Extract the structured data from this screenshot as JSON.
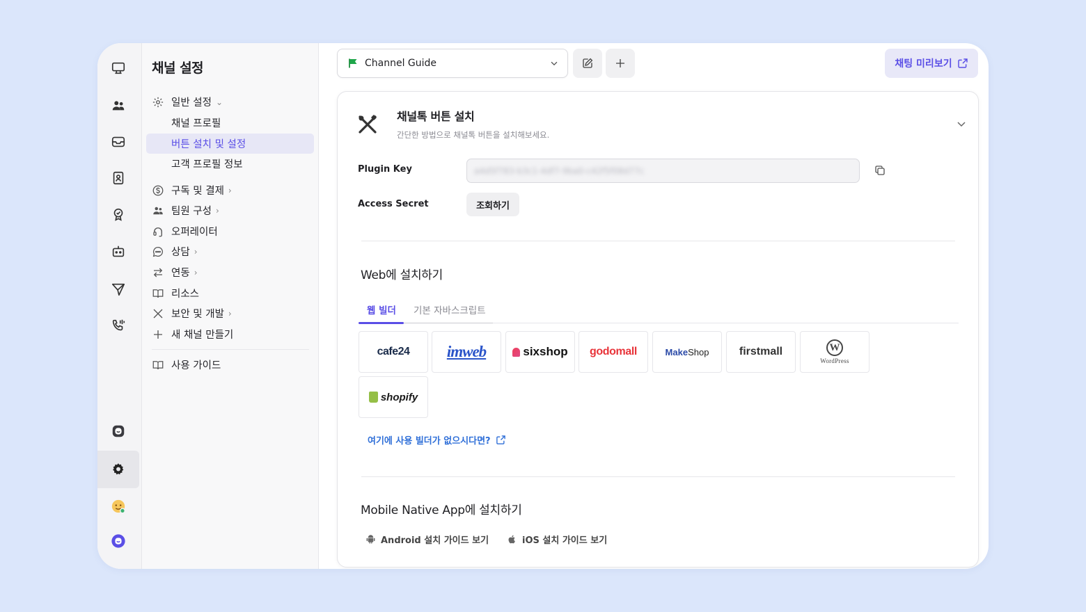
{
  "sidebar": {
    "title": "채널 설정",
    "general": "일반 설정",
    "channel_profile": "채널 프로필",
    "button_setup": "버튼 설치 및 설정",
    "customer_profile": "고객 프로필 정보",
    "subscription": "구독 및 결제",
    "team": "팀원 구성",
    "operator": "오퍼레이터",
    "consult": "상담",
    "integration": "연동",
    "resources": "리소스",
    "security": "보안 및 개발",
    "new_channel": "새 채널 만들기",
    "guide": "사용 가이드"
  },
  "topbar": {
    "channel_select": "Channel Guide",
    "preview_button": "채팅 미리보기"
  },
  "card": {
    "title": "채널톡 버튼 설치",
    "subtitle": "간단한 방법으로 채널톡 버튼을 설치해보세요.",
    "plugin_key_label": "Plugin Key",
    "plugin_key_value": "a4d5f783-b3c1-4df7-9ba0-c42f5f08d77c",
    "access_secret_label": "Access Secret",
    "view_button": "조회하기",
    "web_section_title": "Web에 설치하기",
    "tabs": [
      "웹 빌더",
      "기본 자바스크립트"
    ],
    "builders": {
      "cafe24": "cafe24",
      "imweb": "imweb",
      "sixshop": "sixshop",
      "godomall": "godomall",
      "makeshop_a": "Make",
      "makeshop_b": "Shop",
      "firstmall": "firstmall",
      "wordpress_mark": "W",
      "wordpress": "WordPress",
      "shopify": "shopify"
    },
    "no_builder_link": "여기에 사용 빌더가 없으시다면?",
    "mobile_section_title": "Mobile Native App에 설치하기",
    "android_link": "Android 설치 가이드 보기",
    "ios_link": "iOS 설치 가이드 보기"
  },
  "colors": {
    "accent": "#5a4ee6",
    "link": "#2f6fd8",
    "background": "#dbe6fb"
  }
}
